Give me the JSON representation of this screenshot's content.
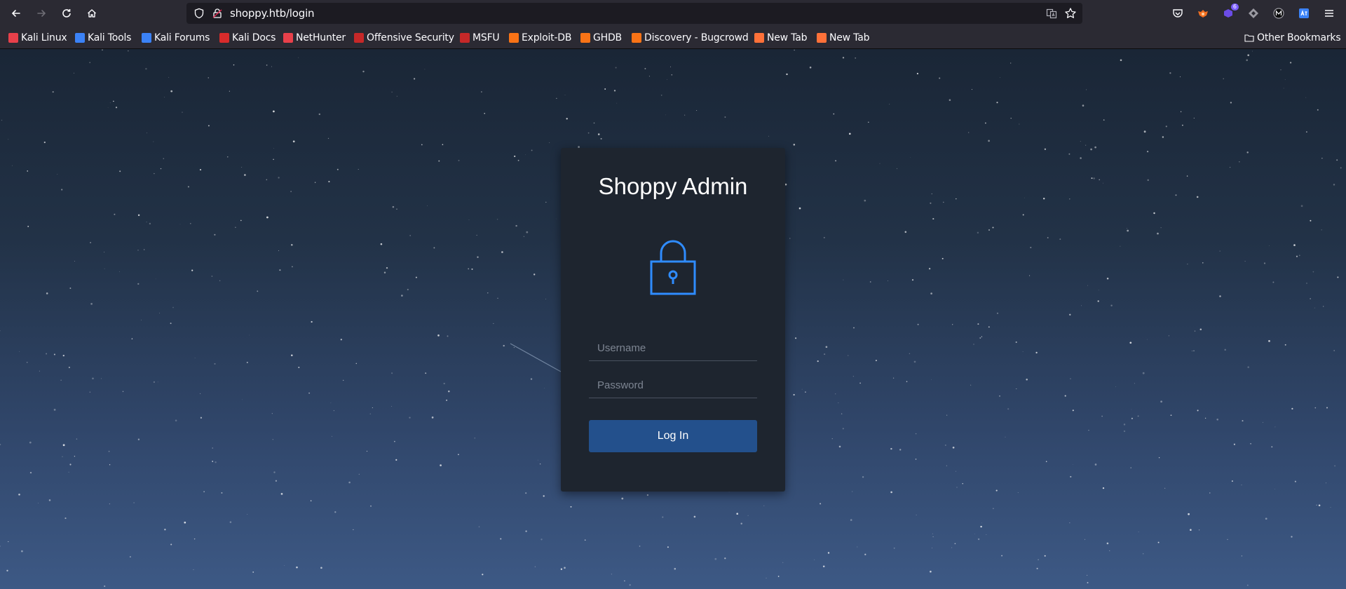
{
  "browser": {
    "url": "shoppy.htb/login",
    "extension_badge": "6",
    "bookmarks": [
      {
        "label": "Kali Linux",
        "color": "#e8404a"
      },
      {
        "label": "Kali Tools",
        "color": "#3b82f6"
      },
      {
        "label": "Kali Forums",
        "color": "#3b82f6"
      },
      {
        "label": "Kali Docs",
        "color": "#d92b2b"
      },
      {
        "label": "NetHunter",
        "color": "#e8404a"
      },
      {
        "label": "Offensive Security",
        "color": "#c62828"
      },
      {
        "label": "MSFU",
        "color": "#c62828"
      },
      {
        "label": "Exploit-DB",
        "color": "#f97316"
      },
      {
        "label": "GHDB",
        "color": "#f97316"
      },
      {
        "label": "Discovery - Bugcrowd",
        "color": "#f97316"
      },
      {
        "label": "New Tab",
        "color": "#ff7139"
      },
      {
        "label": "New Tab",
        "color": "#ff7139"
      }
    ],
    "other_bookmarks": "Other Bookmarks"
  },
  "login": {
    "title": "Shoppy Admin",
    "username_placeholder": "Username",
    "password_placeholder": "Password",
    "button_label": "Log In",
    "accent_color": "#2f8cff",
    "button_color": "#23508c"
  }
}
